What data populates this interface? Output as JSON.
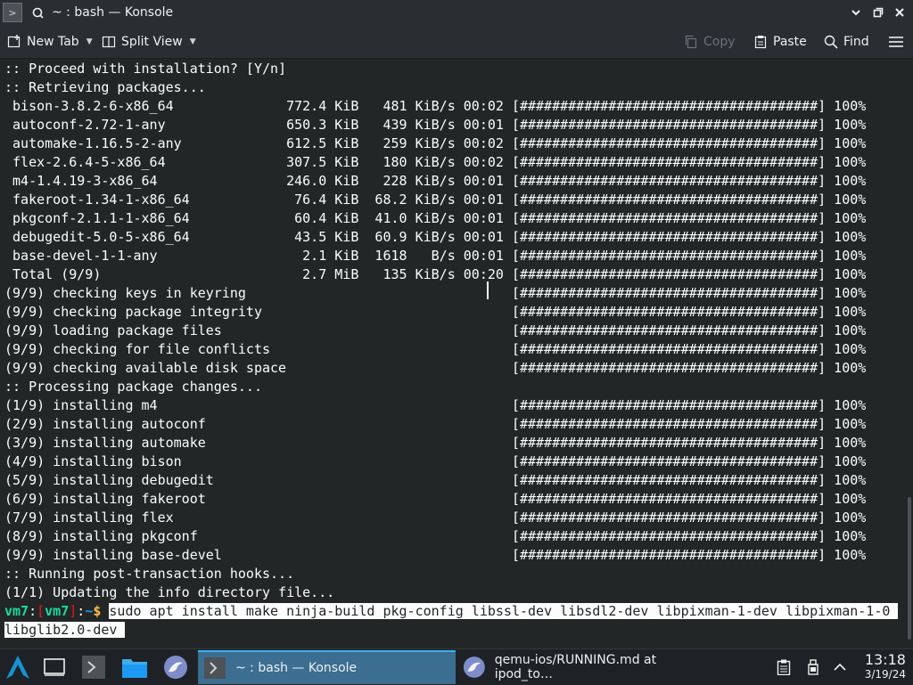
{
  "window": {
    "title": "~ : bash — Konsole"
  },
  "toolbar": {
    "new_tab": "New Tab",
    "split_view": "Split View",
    "copy": "Copy",
    "paste": "Paste",
    "find": "Find"
  },
  "terminal": {
    "lines": [
      ":: Proceed with installation? [Y/n]",
      ":: Retrieving packages...",
      " bison-3.8.2-6-x86_64              772.4 KiB   481 KiB/s 00:02 [#####################################] 100%",
      " autoconf-2.72-1-any               650.3 KiB   439 KiB/s 00:01 [#####################################] 100%",
      " automake-1.16.5-2-any             612.5 KiB   259 KiB/s 00:02 [#####################################] 100%",
      " flex-2.6.4-5-x86_64               307.5 KiB   180 KiB/s 00:02 [#####################################] 100%",
      " m4-1.4.19-3-x86_64                246.0 KiB   228 KiB/s 00:01 [#####################################] 100%",
      " fakeroot-1.34-1-x86_64             76.4 KiB  68.2 KiB/s 00:01 [#####################################] 100%",
      " pkgconf-2.1.1-1-x86_64             60.4 KiB  41.0 KiB/s 00:01 [#####################################] 100%",
      " debugedit-5.0-5-x86_64             43.5 KiB  60.9 KiB/s 00:01 [#####################################] 100%",
      " base-devel-1-1-any                  2.1 KiB  1618   B/s 00:01 [#####################################] 100%",
      " Total (9/9)                         2.7 MiB   135 KiB/s 00:20 [#####################################] 100%",
      "(9/9) checking keys in keyring                                 [#####################################] 100%",
      "(9/9) checking package integrity                               [#####################################] 100%",
      "(9/9) loading package files                                    [#####################################] 100%",
      "(9/9) checking for file conflicts                              [#####################################] 100%",
      "(9/9) checking available disk space                            [#####################################] 100%",
      ":: Processing package changes...",
      "(1/9) installing m4                                            [#####################################] 100%",
      "(2/9) installing autoconf                                      [#####################################] 100%",
      "(3/9) installing automake                                      [#####################################] 100%",
      "(4/9) installing bison                                         [#####################################] 100%",
      "(5/9) installing debugedit                                     [#####################################] 100%",
      "(6/9) installing fakeroot                                      [#####################################] 100%",
      "(7/9) installing flex                                          [#####################################] 100%",
      "(8/9) installing pkgconf                                       [#####################################] 100%",
      "(9/9) installing base-devel                                    [#####################################] 100%",
      ":: Running post-transaction hooks...",
      "(1/1) Updating the info directory file..."
    ],
    "prompt": {
      "user": "vm7",
      "sep": ":",
      "host": "vm7",
      "path": "~",
      "dollar": "$"
    },
    "command_line1": "sudo apt install make ninja-build pkg-config libssl-dev libsdl2-dev libpixman-1-dev libpixman-1-0 ",
    "command_line2": "libglib2.0-dev "
  },
  "taskbar": {
    "tasks": [
      {
        "label": "~ : bash — Konsole",
        "active": true
      },
      {
        "label": "qemu-ios/RUNNING.md at ipod_to…",
        "active": false
      }
    ],
    "time": "13:18",
    "date": "3/19/24"
  },
  "colors": {
    "terminal_bg": "#232627",
    "prompt_green": "#1cdc9a",
    "prompt_red": "#ed1515",
    "prompt_yellow": "#fdbc4b",
    "taskbar_active": "#3b6e91"
  }
}
